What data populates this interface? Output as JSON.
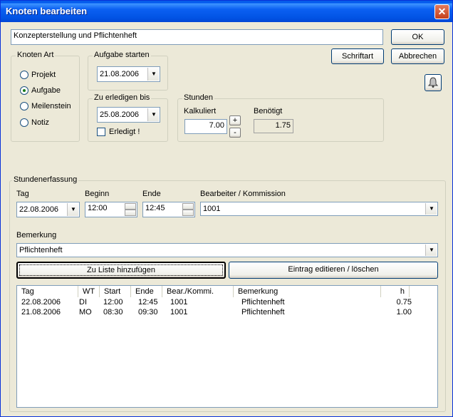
{
  "window": {
    "title": "Knoten bearbeiten",
    "close_label": "✕"
  },
  "name_field": {
    "value": "Konzepterstellung und Pflichtenheft"
  },
  "buttons": {
    "ok": "OK",
    "cancel": "Abbrechen",
    "font": "Schriftart",
    "add_to_list": "Zu Liste hinzufügen",
    "edit_delete": "Eintrag editieren / löschen"
  },
  "knoten_art": {
    "legend": "Knoten Art",
    "options": [
      "Projekt",
      "Aufgabe",
      "Meilenstein",
      "Notiz"
    ],
    "selected": "Aufgabe"
  },
  "aufgabe_start": {
    "legend": "Aufgabe starten",
    "value": "21.08.2006"
  },
  "zu_erledigen": {
    "legend": "Zu erledigen bis",
    "value": "25.08.2006",
    "done_label": "Erledigt !",
    "done_checked": false
  },
  "stunden": {
    "legend": "Stunden",
    "kalkuliert_label": "Kalkuliert",
    "kalkuliert_value": "7.00",
    "benoetigt_label": "Benötigt",
    "benoetigt_value": "1.75",
    "plus": "+",
    "minus": "-"
  },
  "erfassung": {
    "legend": "Stundenerfassung",
    "tag_label": "Tag",
    "tag_value": "22.08.2006",
    "beginn_label": "Beginn",
    "beginn_value": "12:00",
    "ende_label": "Ende",
    "ende_value": "12:45",
    "bearbeiter_label": "Bearbeiter / Kommission",
    "bearbeiter_value": "1001",
    "bemerkung_label": "Bemerkung",
    "bemerkung_value": "Pflichtenheft"
  },
  "table": {
    "columns": [
      "Tag",
      "WT",
      "Start",
      "Ende",
      "Bear./Kommi.",
      "Bemerkung",
      "h"
    ],
    "rows": [
      [
        "22.08.2006",
        "DI",
        "12:00",
        "12:45",
        "1001",
        "Pflichtenheft",
        "0.75"
      ],
      [
        "21.08.2006",
        "MO",
        "08:30",
        "09:30",
        "1001",
        "Pflichtenheft",
        "1.00"
      ]
    ]
  },
  "icons": {
    "bell": "bell-icon",
    "dropdown": "▼"
  }
}
